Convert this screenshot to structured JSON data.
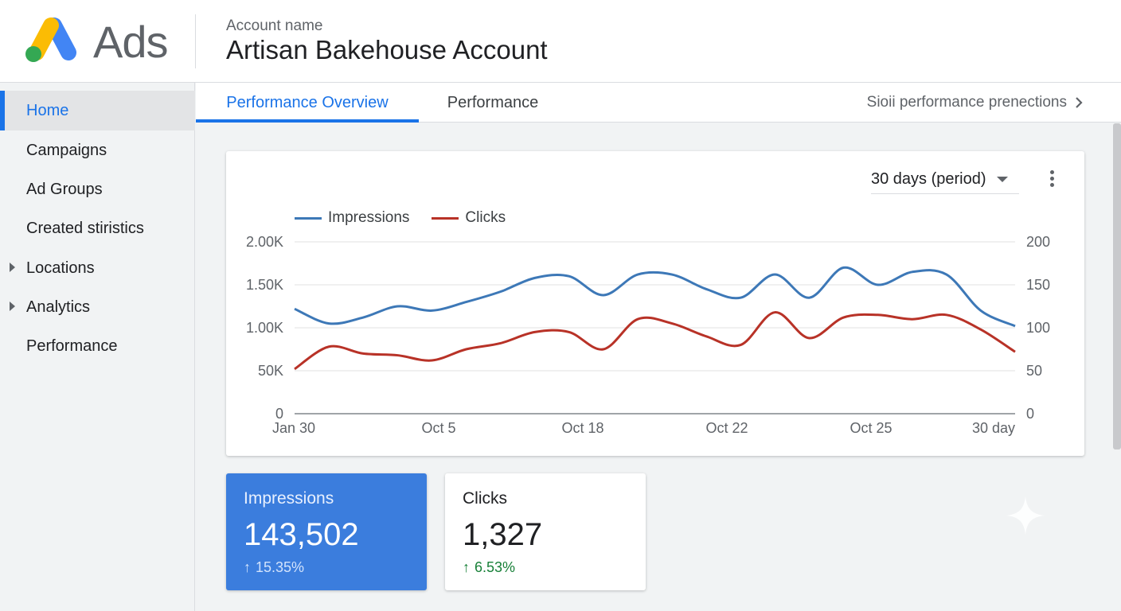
{
  "header": {
    "product_name": "Ads",
    "account_label": "Account name",
    "account_name": "Artisan Bakehouse Account",
    "logo_colors": {
      "blue": "#4285f4",
      "yellow": "#fbbc04",
      "green": "#34a853"
    }
  },
  "sidebar": {
    "items": [
      {
        "label": "Home",
        "active": true,
        "expandable": false
      },
      {
        "label": "Campaigns",
        "active": false,
        "expandable": false
      },
      {
        "label": "Ad Groups",
        "active": false,
        "expandable": false
      },
      {
        "label": "Created stiristics",
        "active": false,
        "expandable": false
      },
      {
        "label": "Locations",
        "active": false,
        "expandable": true
      },
      {
        "label": "Analytics",
        "active": false,
        "expandable": true
      },
      {
        "label": "Performance",
        "active": false,
        "expandable": false
      }
    ]
  },
  "tabs": {
    "items": [
      {
        "label": "Performance Overview",
        "active": true
      },
      {
        "label": "Performance",
        "active": false
      }
    ],
    "right_link": "Sioii performance prenections",
    "right_icon": "chevron-right-icon"
  },
  "chart_card": {
    "period_select": "30 days (period)",
    "menu_icon": "more-vert-icon"
  },
  "chart_data": {
    "type": "line",
    "x": [
      "Jan 30",
      "Oct 5",
      "Oct 18",
      "Oct 22",
      "Oct 25",
      "30 day"
    ],
    "y_left": {
      "ticks": [
        "0",
        "50K",
        "1.00K",
        "1.50K",
        "2.00K"
      ]
    },
    "y_right": {
      "ticks": [
        "0",
        "50",
        "100",
        "150",
        "200"
      ],
      "ylim": [
        0,
        200
      ]
    },
    "grid": true,
    "legend": "top-left",
    "series": [
      {
        "name": "Impressions",
        "color": "#3d78b7",
        "axis": "left",
        "values": [
          1.22,
          1.05,
          1.12,
          1.25,
          1.2,
          1.3,
          1.42,
          1.58,
          1.6,
          1.38,
          1.62,
          1.62,
          1.45,
          1.35,
          1.62,
          1.35,
          1.7,
          1.5,
          1.65,
          1.62,
          1.2,
          1.02
        ]
      },
      {
        "name": "Clicks",
        "color": "#b83227",
        "axis": "left",
        "values": [
          0.52,
          0.78,
          0.7,
          0.68,
          0.62,
          0.75,
          0.82,
          0.95,
          0.95,
          0.75,
          1.1,
          1.05,
          0.9,
          0.8,
          1.18,
          0.88,
          1.12,
          1.15,
          1.1,
          1.15,
          0.98,
          0.72
        ]
      }
    ]
  },
  "stats": [
    {
      "label": "Impressions",
      "value": "143,502",
      "change": "15.35%",
      "direction": "up",
      "highlight": true
    },
    {
      "label": "Clicks",
      "value": "1,327",
      "change": "6.53%",
      "direction": "up",
      "highlight": false
    }
  ]
}
